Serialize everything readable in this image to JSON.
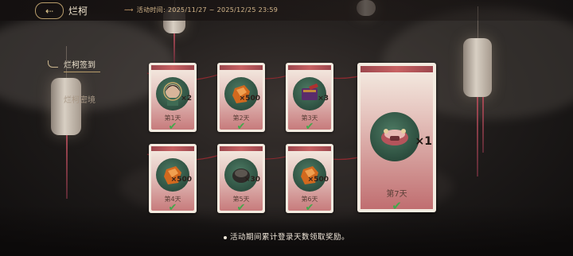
{
  "header": {
    "back_arrow": "⇠",
    "title": "烂柯",
    "time_arrow": "⟿",
    "time_text": "活动时间:  2025/11/27 ~ 2025/12/25 23:59"
  },
  "sidebar": {
    "items": [
      {
        "label": "烂柯签到"
      },
      {
        "label": "烂柯密境"
      }
    ]
  },
  "cards": [
    {
      "day": "第1天",
      "qty": "×2",
      "item": "character-portrait",
      "claimed": true
    },
    {
      "day": "第2天",
      "qty": "×500",
      "item": "amber-stone",
      "claimed": true
    },
    {
      "day": "第3天",
      "qty": "×3",
      "item": "purple-book",
      "claimed": true
    },
    {
      "day": "第4天",
      "qty": "×500",
      "item": "amber-stone",
      "claimed": true
    },
    {
      "day": "第5天",
      "qty": "×30",
      "item": "dark-bowl",
      "claimed": true
    },
    {
      "day": "第6天",
      "qty": "×500",
      "item": "amber-stone",
      "claimed": true
    }
  ],
  "big_card": {
    "day": "第7天",
    "qty": "×1",
    "item": "ornate-chest",
    "claimed": true
  },
  "check_glyph": "✔",
  "footer": {
    "text": "活动期间累计登录天数领取奖励。"
  },
  "colors": {
    "accent": "#b79c6a",
    "claimed_check": "#43a84b",
    "card_red": "#c04a4d"
  }
}
